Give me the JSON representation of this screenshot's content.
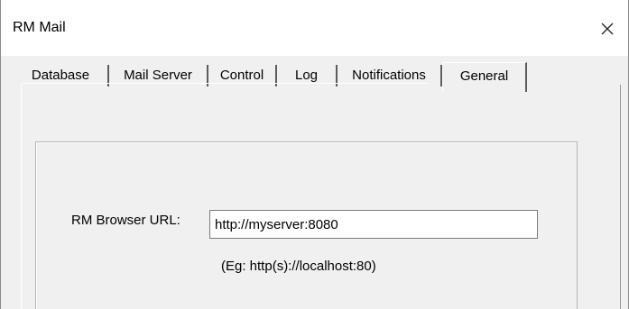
{
  "window": {
    "title": "RM Mail",
    "close_icon": "close-icon"
  },
  "tabs": [
    {
      "label": "Database",
      "selected": false
    },
    {
      "label": "Mail Server",
      "selected": false
    },
    {
      "label": "Control",
      "selected": false
    },
    {
      "label": "Log",
      "selected": false
    },
    {
      "label": "Notifications",
      "selected": false
    },
    {
      "label": "General",
      "selected": true
    }
  ],
  "general": {
    "url_label": "RM Browser URL:",
    "url_value": "http://myserver:8080",
    "hint": "(Eg: http(s)://localhost:80)"
  }
}
